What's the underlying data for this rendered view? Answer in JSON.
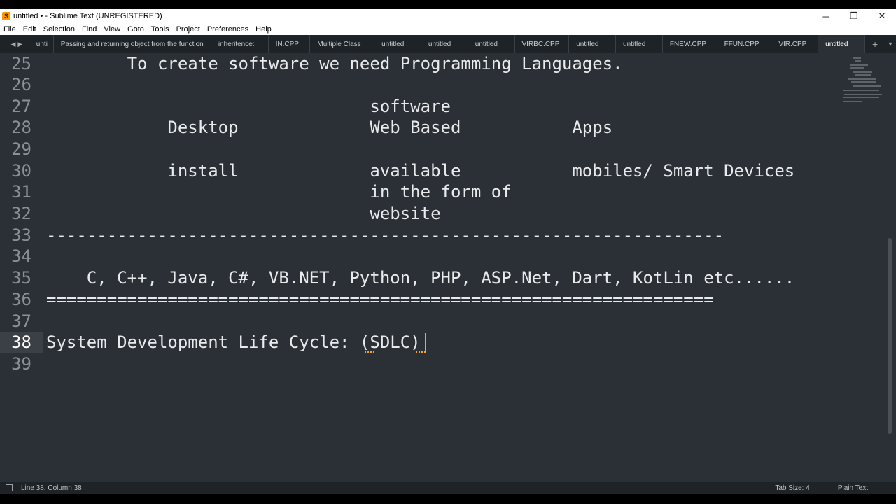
{
  "window": {
    "title": "untitled • - Sublime Text (UNREGISTERED)",
    "app_icon": "S",
    "controls": {
      "minimize": "─",
      "maximize": "❐",
      "close": "✕"
    }
  },
  "menu": [
    "File",
    "Edit",
    "Selection",
    "Find",
    "View",
    "Goto",
    "Tools",
    "Project",
    "Preferences",
    "Help"
  ],
  "tabs": [
    {
      "label": "unti",
      "active": false
    },
    {
      "label": "Passing and returning object from the function",
      "active": false
    },
    {
      "label": "inheritence:",
      "active": false
    },
    {
      "label": "IN.CPP",
      "active": false
    },
    {
      "label": "Multiple Class",
      "active": false
    },
    {
      "label": "untitled",
      "active": false
    },
    {
      "label": "untitled",
      "active": false
    },
    {
      "label": "untitled",
      "active": false
    },
    {
      "label": "VIRBC.CPP",
      "active": false
    },
    {
      "label": "untitled",
      "active": false
    },
    {
      "label": "untitled",
      "active": false
    },
    {
      "label": "FNEW.CPP",
      "active": false
    },
    {
      "label": "FFUN.CPP",
      "active": false
    },
    {
      "label": "VIR.CPP",
      "active": false
    },
    {
      "label": "untitled",
      "active": true
    }
  ],
  "tab_controls": {
    "left": "◀",
    "right": "▶",
    "new": "+",
    "more": "▾"
  },
  "editor": {
    "lines": [
      {
        "num": "25",
        "text": "        To create software we need Programming Languages."
      },
      {
        "num": "26",
        "text": ""
      },
      {
        "num": "27",
        "text": "                                software"
      },
      {
        "num": "28",
        "text": "            Desktop             Web Based           Apps"
      },
      {
        "num": "29",
        "text": ""
      },
      {
        "num": "30",
        "text": "            install             available           mobiles/ Smart Devices"
      },
      {
        "num": "31",
        "text": "                                in the form of"
      },
      {
        "num": "32",
        "text": "                                website"
      },
      {
        "num": "33",
        "text": "-------------------------------------------------------------------"
      },
      {
        "num": "34",
        "text": ""
      },
      {
        "num": "35",
        "text": "    C, C++, Java, C#, VB.NET, Python, PHP, ASP.Net, Dart, KotLin etc......"
      },
      {
        "num": "36",
        "text": "=================================================================="
      },
      {
        "num": "37",
        "text": ""
      },
      {
        "num": "38",
        "text": "System Development Life Cycle: (SDLC)"
      },
      {
        "num": "39",
        "text": ""
      }
    ],
    "current_line": "38"
  },
  "status": {
    "position": "Line 38, Column 38",
    "tab_size": "Tab Size: 4",
    "syntax": "Plain Text"
  },
  "colors": {
    "editor_bg": "#2b3036",
    "chrome_bg": "#1e2328",
    "caret": "#f5a623",
    "text": "#e8eaec"
  }
}
